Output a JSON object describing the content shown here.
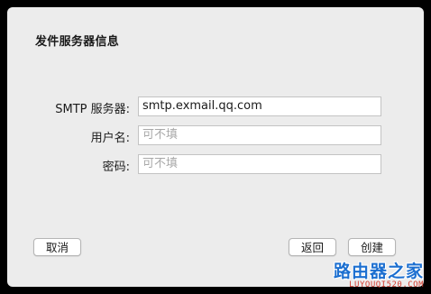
{
  "dialog": {
    "title": "发件服务器信息"
  },
  "form": {
    "smtp": {
      "label": "SMTP 服务器:",
      "value": "smtp.exmail.qq.com"
    },
    "username": {
      "label": "用户名:",
      "placeholder": "可不填"
    },
    "password": {
      "label": "密码:",
      "placeholder": "可不填"
    }
  },
  "buttons": {
    "cancel": "取消",
    "back": "返回",
    "create": "创建"
  },
  "watermark": {
    "title": "路由器之家",
    "subtitle": "LUYOUQI520.COM"
  }
}
